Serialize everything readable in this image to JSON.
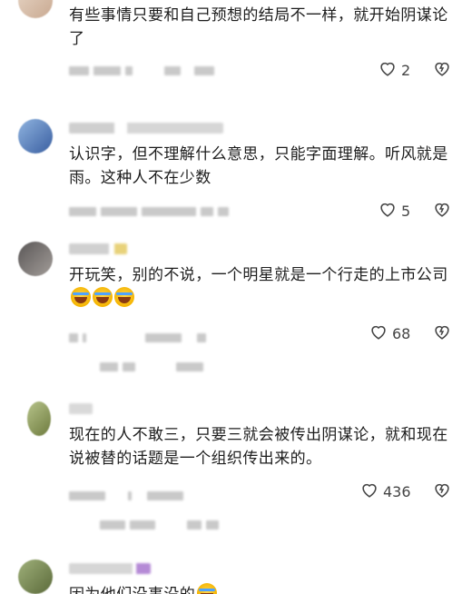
{
  "comments": [
    {
      "text": "有些事情只要和自己预想的结局不一样，就开始阴谋论了",
      "likes": "2"
    },
    {
      "text": "认识字，但不理解什么意思，只能字面理解。听风就是雨。这种人不在少数",
      "likes": "5"
    },
    {
      "text": "开玩笑，别的不说，一个明星就是一个行走的上市公司",
      "likes": "68"
    },
    {
      "text": "现在的人不敢三，只要三就会被传出阴谋论，就和现在说被替的话题是一个组织传出来的。",
      "likes": "436"
    },
    {
      "text": "因为他们没事没的",
      "likes": ""
    }
  ],
  "icons": {
    "like": "heart-outline-icon",
    "dislike": "broken-heart-icon"
  },
  "colors": {
    "text": "#1d1d1d",
    "icon": "#444444",
    "background": "#ffffff"
  }
}
